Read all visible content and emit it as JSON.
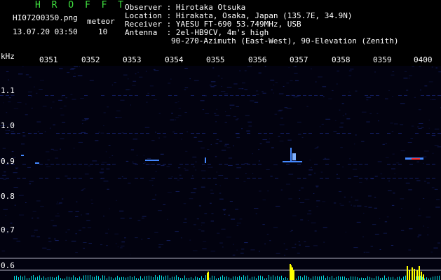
{
  "header": {
    "app_title": "H R O F F T",
    "file_name": "HI07200350.png",
    "meteor_label": "meteor",
    "date_time": "13.07.20 03:50",
    "meteor_count": "10"
  },
  "station_info": {
    "observer": "Observer : Hirotaka Otsuka",
    "location": "Location : Hirakata, Osaka, Japan (135.7E, 34.9N)",
    "receiver": "Receiver : YAESU FT-690 53.749MHz, USB",
    "antenna": "Antenna  : 2el-HB9CV, 4m's high",
    "antenna_detail": "90-270-Azimuth (East-West), 90-Elevation (Zenith)"
  },
  "spectrogram": {
    "y_unit": "kHz",
    "x_ticks": [
      "0351",
      "0352",
      "0353",
      "0354",
      "0355",
      "0356",
      "0357",
      "0358",
      "0359",
      "0400"
    ],
    "y_ticks": [
      "1.1",
      "1.0",
      "0.9",
      "0.8",
      "0.7",
      "0.6"
    ],
    "colors": {
      "background": "#000000",
      "plot_background": "#02020f",
      "header_green": "#3fe03f",
      "text": "#ffffff",
      "noise": "#1a2a80",
      "signal": "#4488ff",
      "echo_red": "#ff3030",
      "meter_yellow": "#ffff00",
      "meter_cyan": "#00e0e0"
    }
  }
}
